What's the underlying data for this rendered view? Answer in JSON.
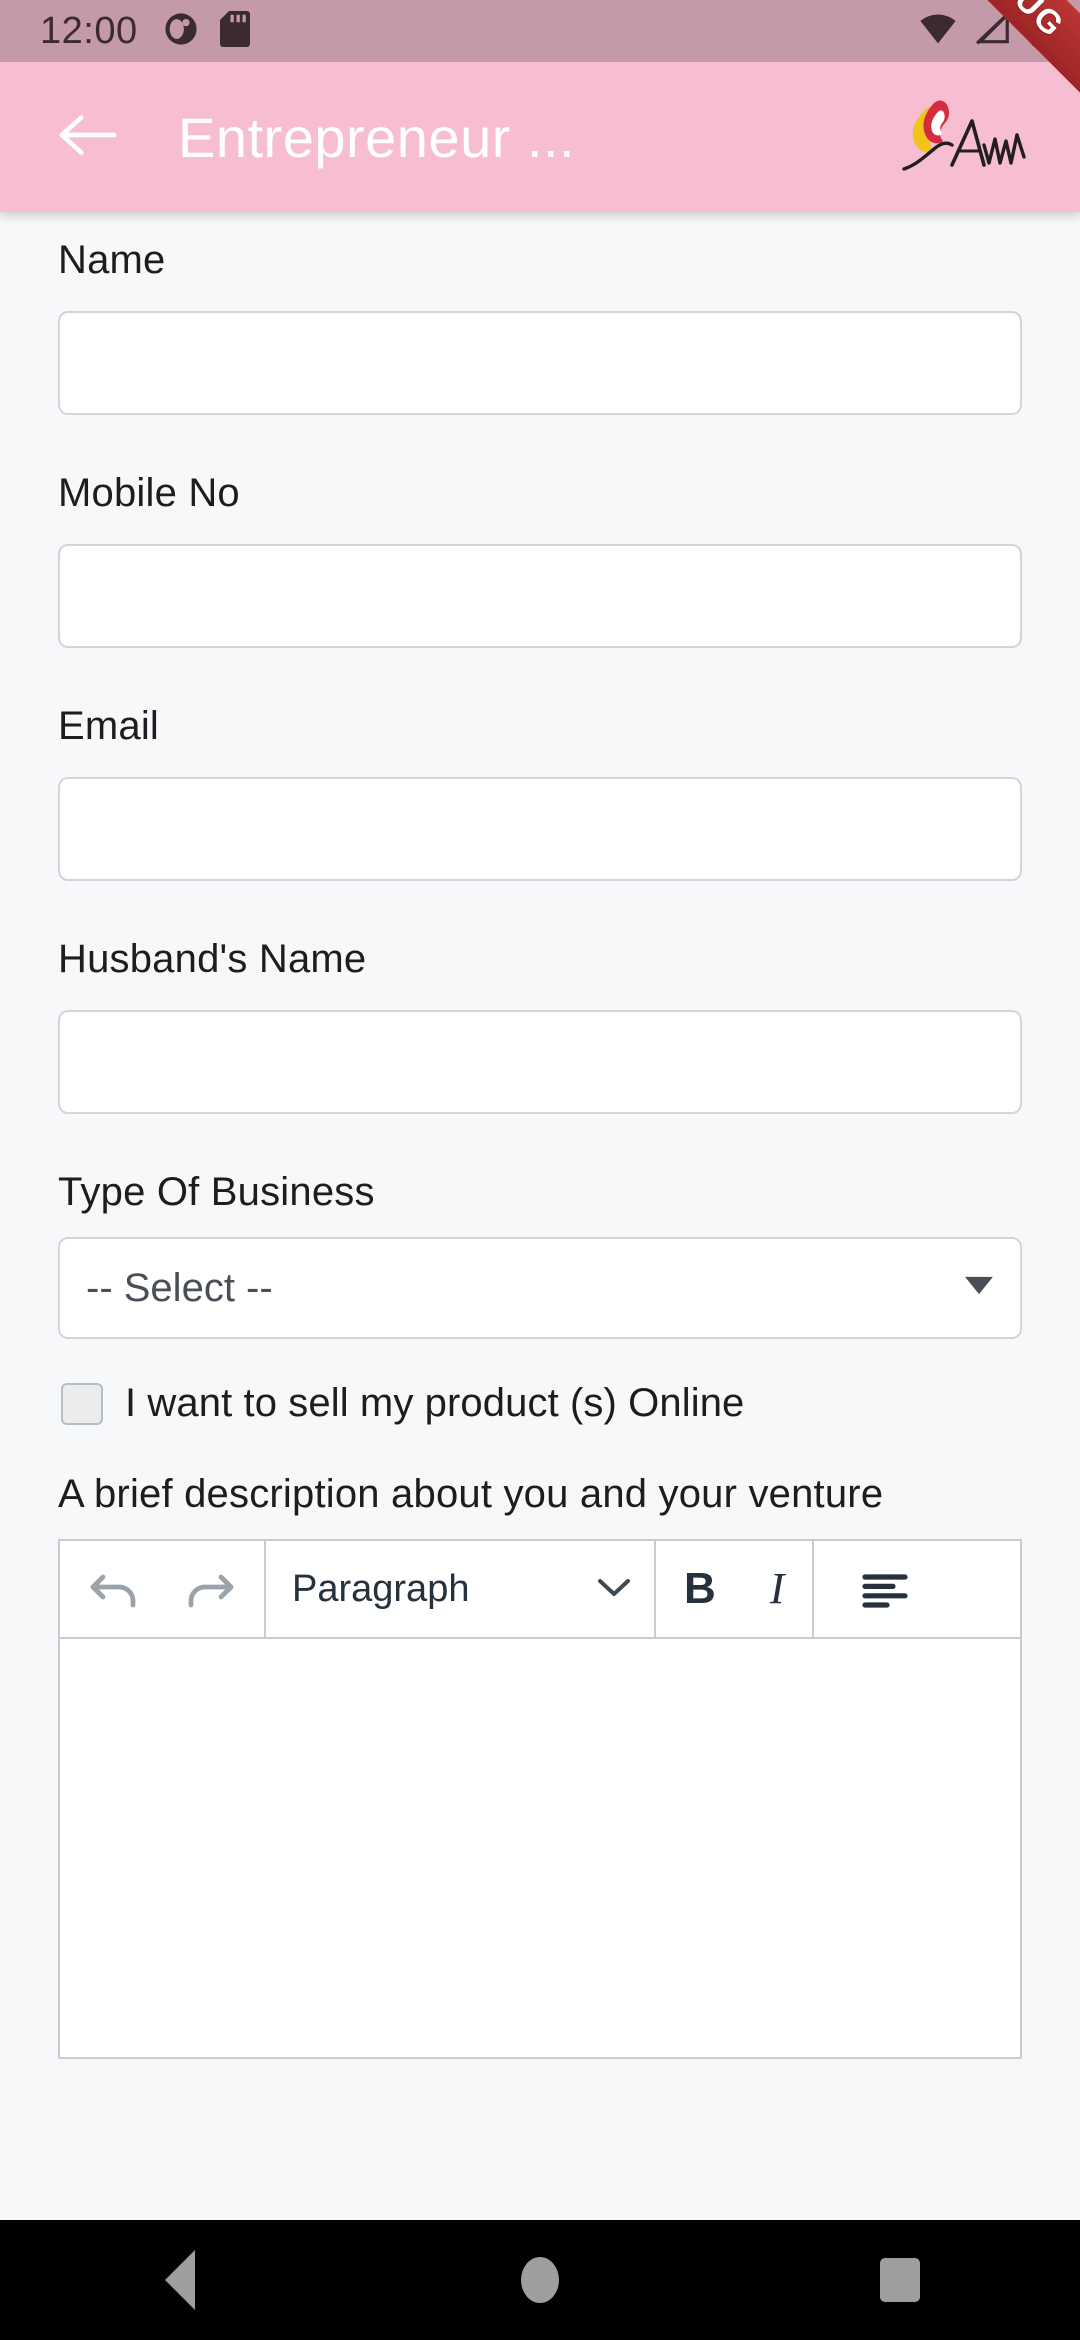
{
  "status_bar": {
    "clock": "12:00",
    "icons_left": [
      "moon-icon",
      "sd-card-icon"
    ],
    "icons_right": [
      "wifi-icon",
      "signal-off-icon",
      "battery-icon"
    ],
    "background": "#c59aa8"
  },
  "debug_ribbon": {
    "label": "DEBUG",
    "color": "#a82b2b"
  },
  "app_bar": {
    "back_icon": "arrow-left-icon",
    "title": "Entrepreneur ...",
    "logo_alt": "AWA",
    "background": "#f7bdd0",
    "title_color": "#ffffff"
  },
  "form": {
    "fields": [
      {
        "label": "Name",
        "value": "",
        "placeholder": "",
        "type": "text"
      },
      {
        "label": "Mobile No",
        "value": "",
        "placeholder": "",
        "type": "text"
      },
      {
        "label": "Email",
        "value": "",
        "placeholder": "",
        "type": "text"
      },
      {
        "label": "Husband's Name",
        "value": "",
        "placeholder": "",
        "type": "text"
      }
    ],
    "business_type": {
      "label": "Type Of Business",
      "selected": "-- Select --",
      "arrow_icon": "triangle-down-icon"
    },
    "sell_online": {
      "label": "I want to sell my product (s) Online",
      "checked": false
    },
    "description": {
      "label": "A brief description about you and your venture",
      "value": "",
      "toolbar": {
        "undo_icon": "undo-icon",
        "redo_icon": "redo-icon",
        "block_style": "Paragraph",
        "block_style_arrow": "chevron-down-icon",
        "bold_label": "B",
        "italic_label": "I",
        "align_icon": "align-left-icon"
      }
    }
  },
  "nav_bar": {
    "back": "back-triangle-icon",
    "home": "home-circle-icon",
    "recents": "recents-square-icon",
    "background": "#000000"
  }
}
